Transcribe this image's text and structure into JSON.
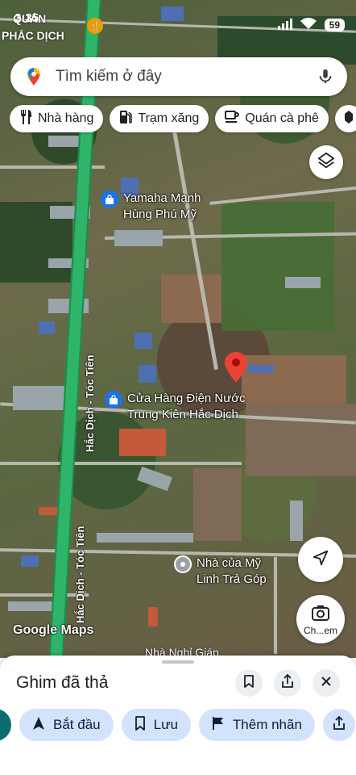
{
  "status_bar": {
    "time": "3:35",
    "battery": "59"
  },
  "map": {
    "corner_labels": [
      "QUÁN",
      "PHẮC DỊCH"
    ],
    "road_labels": [
      "Hắc Dịch - Tóc Tiên",
      "Hắc Dịch - Tóc Tiên"
    ],
    "places": [
      {
        "name_line1": "Yamaha Mạnh",
        "name_line2": "Hùng Phú Mỹ"
      },
      {
        "name_line1": "Cửa Hàng Điện Nước",
        "name_line2": "Trung Kiên Hắc Dịch"
      },
      {
        "name_line1": "Nhà của Mỹ",
        "name_line2": "Linh Trả Góp"
      }
    ],
    "logo": "Google Maps",
    "bottom_label": "Nhà Nghỉ Giáp",
    "lens_label": "Ch...em"
  },
  "search": {
    "placeholder": "Tìm kiếm ở đây"
  },
  "chips": [
    {
      "label": "Nhà hàng",
      "icon": "restaurant-icon"
    },
    {
      "label": "Trạm xăng",
      "icon": "gas-station-icon"
    },
    {
      "label": "Quán cà phê",
      "icon": "coffee-icon"
    }
  ],
  "sheet": {
    "title": "Ghim đã thả",
    "actions": [
      {
        "label": "Bắt đầu",
        "icon": "navigation-arrow-icon"
      },
      {
        "label": "Lưu",
        "icon": "bookmark-icon"
      },
      {
        "label": "Thêm nhãn",
        "icon": "flag-icon"
      }
    ]
  },
  "colors": {
    "accent": "#1a73e8",
    "pin_red": "#ea4335",
    "road_green": "#2fb56a",
    "action_bg": "#d3e3fd"
  }
}
